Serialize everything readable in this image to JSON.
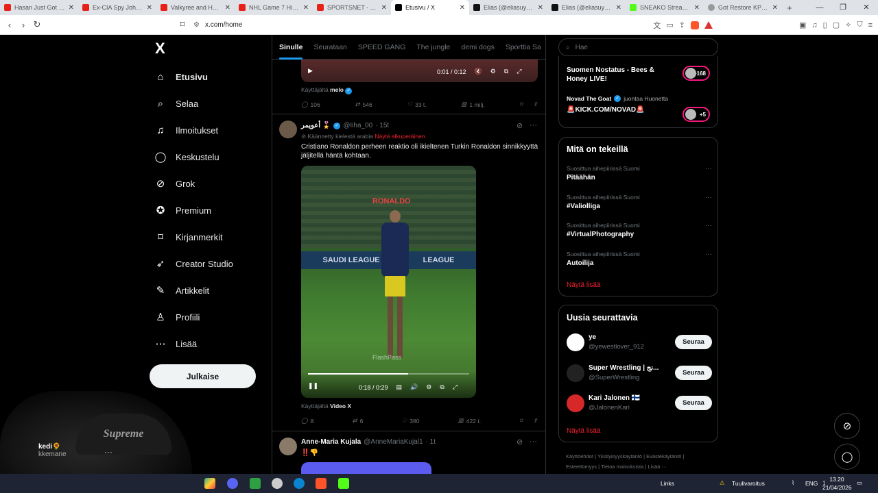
{
  "browser": {
    "tabs": [
      {
        "title": "Hasan Just Got F**king",
        "fav": "yt"
      },
      {
        "title": "Ex-CIA Spy John Kiriak",
        "fav": "yt"
      },
      {
        "title": "Valkyree and Hasan Re",
        "fav": "yt"
      },
      {
        "title": "NHL Game 7 Highlights",
        "fav": "yt"
      },
      {
        "title": "SPORTSNET - YouTube",
        "fav": "yt"
      },
      {
        "title": "Etusivu / X",
        "fav": "x",
        "active": true
      },
      {
        "title": "Elias (@eliasuysal1) on",
        "fav": "tt"
      },
      {
        "title": "Elias (@eliasuysal1) | T",
        "fav": "tt"
      },
      {
        "title": "SNEAKO Stream - Wat",
        "fav": "kick"
      },
      {
        "title": "Got Restore KPV + LAV",
        "fav": "gen"
      }
    ],
    "new_tab_icon": "+",
    "url": "x.com/home"
  },
  "nav": {
    "logo": "X",
    "items": [
      {
        "label": "Etusivu",
        "icon": "home-icon",
        "glyph": "⌂",
        "active": true
      },
      {
        "label": "Selaa",
        "icon": "search-icon",
        "glyph": "⌕"
      },
      {
        "label": "Ilmoitukset",
        "icon": "bell-icon",
        "glyph": "♫"
      },
      {
        "label": "Keskustelu",
        "icon": "chat-icon",
        "glyph": "◯"
      },
      {
        "label": "Grok",
        "icon": "grok-icon",
        "glyph": "⊘"
      },
      {
        "label": "Premium",
        "icon": "premium-icon",
        "glyph": "✪"
      },
      {
        "label": "Kirjanmerkit",
        "icon": "bookmark-icon",
        "glyph": "⌑"
      },
      {
        "label": "Creator Studio",
        "icon": "rocket-icon",
        "glyph": "➶"
      },
      {
        "label": "Artikkelit",
        "icon": "article-icon",
        "glyph": "✎"
      },
      {
        "label": "Profiili",
        "icon": "profile-icon",
        "glyph": "♙"
      },
      {
        "label": "Lisää",
        "icon": "more-icon",
        "glyph": "⋯"
      }
    ],
    "post_button": "Julkaise",
    "user_name": "kedi🌻",
    "user_handle": "kkemane",
    "webcam_text": "Supreme"
  },
  "feed": {
    "tabs": [
      "Sinulle",
      "Seurataan",
      "SPEED GANG",
      "The jungle",
      "demi dogs",
      "Sporttia Sa"
    ],
    "post1": {
      "video_time": "0:01 / 0:12",
      "attribution_prefix": "Käyttäjältä",
      "attribution_user": "melo",
      "replies": "106",
      "reposts": "546",
      "likes": "33 t.",
      "views": "1 milj."
    },
    "post2": {
      "name": "أعويمر 🎖️",
      "handle": "@Iiha_00",
      "time": "· 15t",
      "translated": "Käännetty kielestä arabia",
      "show_original": "Näytä alkuperäinen",
      "text": "Cristiano Ronaldon perheen reaktio oli ikieltenen Turkin Ronaldon sinnikkyyttä jäljitellä häntä kohtaan.",
      "video_overlay_name": "RONALDO",
      "banner_left": "SAUDI LEAGUE",
      "banner_right": "LEAGUE",
      "watermark": "FlashPass",
      "video_time": "0:18 / 0:29",
      "progress": 0.62,
      "attribution_prefix": "Käyttäjältä",
      "attribution_user": "Video X",
      "replies": "8",
      "reposts": "6",
      "likes": "380",
      "views": "422 t."
    },
    "post3": {
      "name": "Anne-Maria Kujala",
      "handle": "@AnneMariaKujal1",
      "time": "· 1t",
      "text": "‼️👎"
    }
  },
  "right": {
    "search_placeholder": "Hae",
    "live": [
      {
        "title": "Suomen Nostatus - Bees & Honey LIVE!",
        "badge": "+168"
      },
      {
        "by": "Novad The Goat",
        "joined": "juontaa Huonetta",
        "title": "🚨KICK.COM/NOVAD🚨",
        "badge": "+5"
      }
    ],
    "trends_title": "Mitä on tekeillä",
    "trends": [
      {
        "category": "Suosittua aihepiirissä Suomi",
        "name": "Pitäähän"
      },
      {
        "category": "Suosittua aihepiirissä Suomi",
        "name": "#Valiolliga"
      },
      {
        "category": "Suosittua aihepiirissä Suomi",
        "name": "#VirtualPhotography"
      },
      {
        "category": "Suosittua aihepiirissä Suomi",
        "name": "Autoilija"
      }
    ],
    "show_more": "Näytä lisää",
    "follow_title": "Uusia seurattavia",
    "follow": [
      {
        "name": "ye",
        "handle": "@yewestlover_912",
        "btn": "Seuraa",
        "color": "#ffffff"
      },
      {
        "name": "Super Wrestling | نج...",
        "handle": "@SuperWrestling",
        "btn": "Seuraa",
        "color": "#222222"
      },
      {
        "name": "Kari Jalonen 🇫🇮",
        "handle": "@JalonenKari",
        "btn": "Seuraa",
        "color": "#d62828"
      }
    ],
    "footer": "Käyttöehdot | Yksityisyyskäytäntö | Evästekäytäntö | Esteettömyys | Tietoa mainoksista | Lisää ···"
  },
  "taskbar": {
    "links": "Links",
    "weather": "Tuulivaroitus",
    "lang": "ENG",
    "time": "13.20",
    "date": "21/04/2026"
  }
}
